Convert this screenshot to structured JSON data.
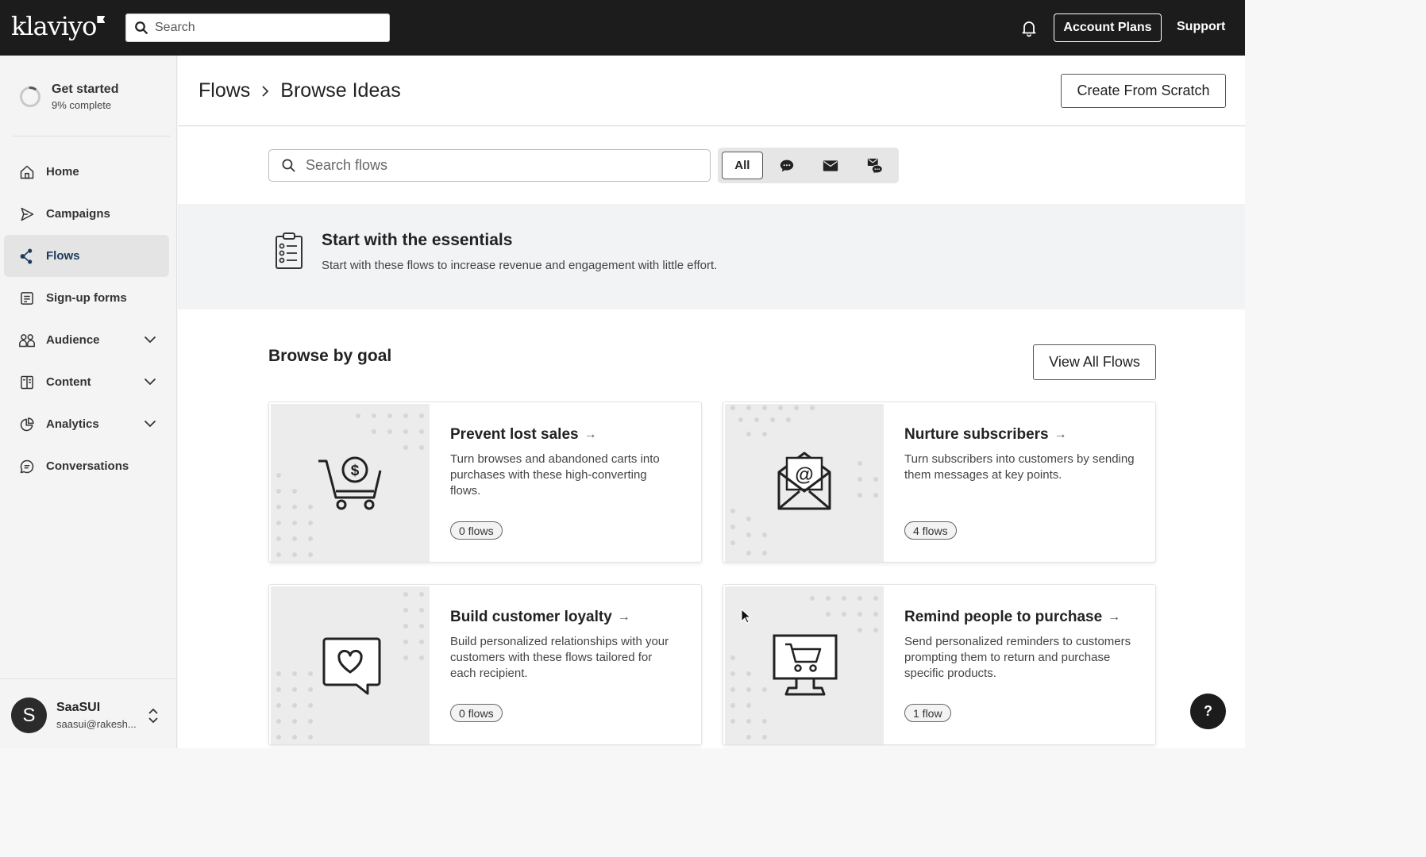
{
  "topbar": {
    "logo": "klaviyo",
    "search_placeholder": "Search",
    "account_plans": "Account Plans",
    "support": "Support"
  },
  "sidebar": {
    "get_started": {
      "title": "Get started",
      "progress": "9% complete",
      "progress_value": 0.09
    },
    "items": [
      {
        "label": "Home",
        "icon": "home-icon"
      },
      {
        "label": "Campaigns",
        "icon": "send-icon"
      },
      {
        "label": "Flows",
        "icon": "flows-icon",
        "active": true
      },
      {
        "label": "Sign-up forms",
        "icon": "form-icon"
      },
      {
        "label": "Audience",
        "icon": "audience-icon",
        "expandable": true
      },
      {
        "label": "Content",
        "icon": "content-icon",
        "expandable": true
      },
      {
        "label": "Analytics",
        "icon": "analytics-icon",
        "expandable": true
      },
      {
        "label": "Conversations",
        "icon": "chat-icon"
      }
    ],
    "user": {
      "initial": "S",
      "name": "SaaSUI",
      "email": "saasui@rakesh..."
    }
  },
  "header": {
    "breadcrumb_root": "Flows",
    "breadcrumb_current": "Browse Ideas",
    "create_button": "Create From Scratch"
  },
  "filters": {
    "search_placeholder": "Search flows",
    "all_label": "All",
    "options": [
      "sms-icon",
      "email-icon",
      "email-and-sms-icon"
    ]
  },
  "essentials": {
    "title": "Start with the essentials",
    "subtitle": "Start with these flows to increase revenue and engagement with little effort."
  },
  "browse": {
    "title": "Browse by goal",
    "view_all": "View All Flows",
    "cards": [
      {
        "title": "Prevent lost sales",
        "description": "Turn browses and abandoned carts into purchases with these high-converting flows.",
        "badge": "0 flows",
        "icon": "cart-dollar-icon"
      },
      {
        "title": "Nurture subscribers",
        "description": "Turn subscribers into customers by sending them messages at key points.",
        "badge": "4 flows",
        "icon": "envelope-at-icon"
      },
      {
        "title": "Build customer loyalty",
        "description": "Build personalized relationships with your customers with these flows tailored for each recipient.",
        "badge": "0 flows",
        "icon": "heart-bubble-icon"
      },
      {
        "title": "Remind people to purchase",
        "description": "Send personalized reminders to customers prompting them to return and purchase specific products.",
        "badge": "1 flow",
        "icon": "monitor-cart-icon"
      }
    ]
  },
  "help": {
    "label": "?"
  },
  "colors": {
    "topbar": "#1c1c1c",
    "active_nav": "#e4e4e4",
    "accent": "#1b3a5c"
  }
}
